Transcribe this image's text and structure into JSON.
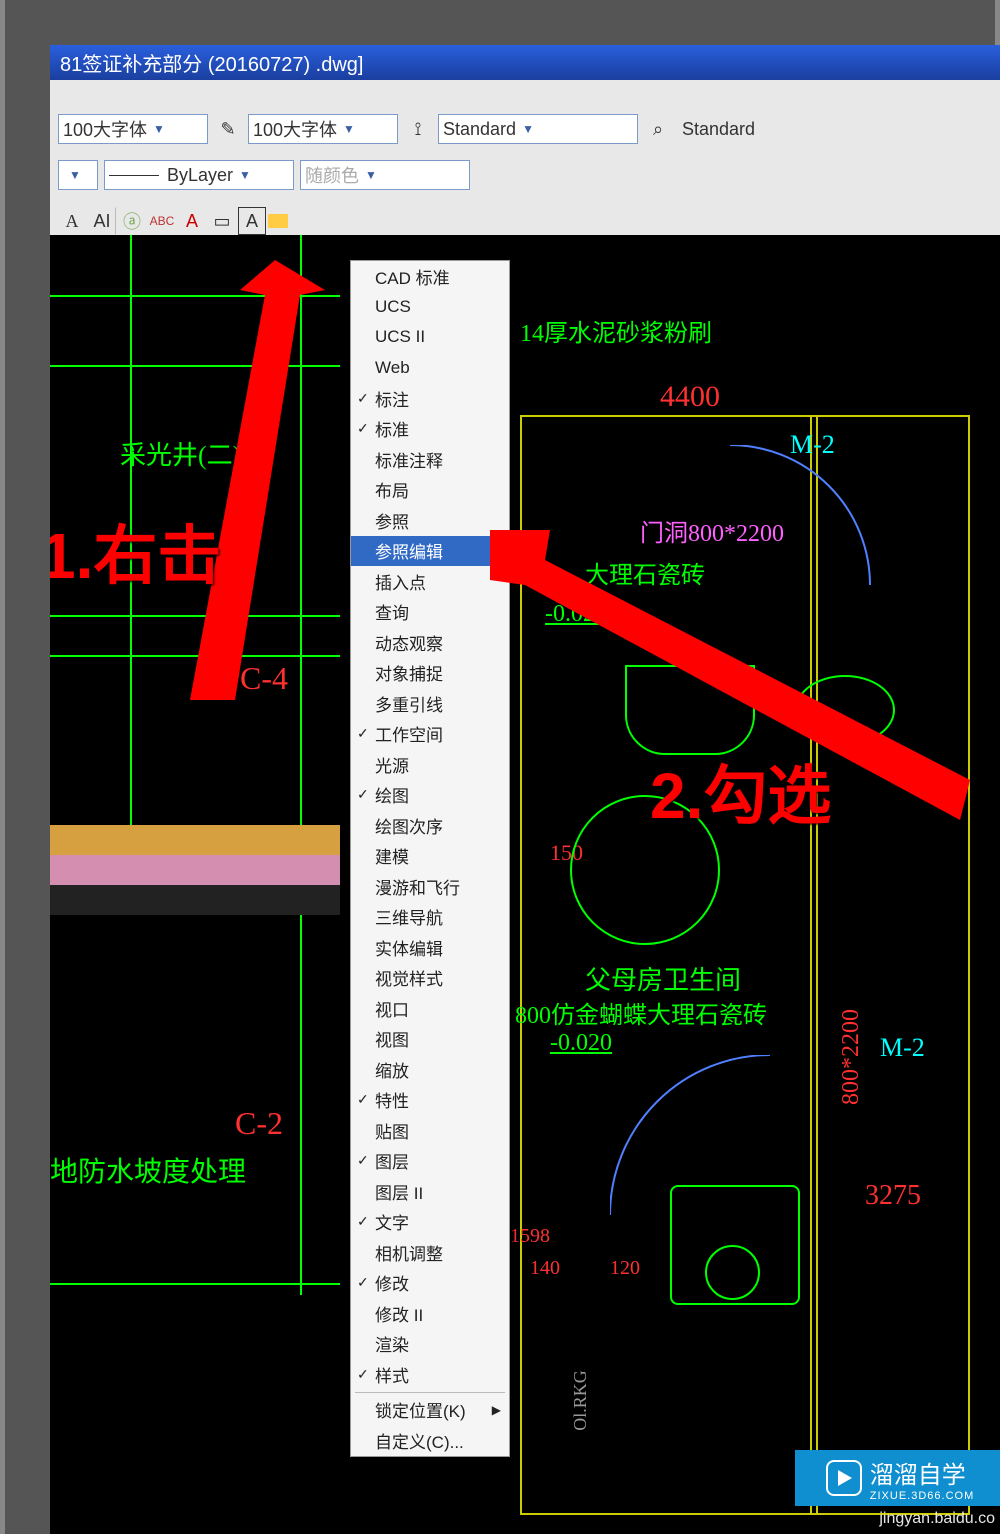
{
  "titlebar": {
    "text": "81签证补充部分 (20160727) .dwg]"
  },
  "toolbar": {
    "font1": "100大字体",
    "font2": "100大字体",
    "style1": "Standard",
    "style2": "Standard",
    "layer_style": "ByLayer",
    "color": "随颜色"
  },
  "context_menu": {
    "items": [
      {
        "label": "CAD 标准",
        "checked": false
      },
      {
        "label": "UCS",
        "checked": false
      },
      {
        "label": "UCS II",
        "checked": false
      },
      {
        "label": "Web",
        "checked": false
      },
      {
        "label": "标注",
        "checked": true
      },
      {
        "label": "标准",
        "checked": true
      },
      {
        "label": "标准注释",
        "checked": false
      },
      {
        "label": "布局",
        "checked": false
      },
      {
        "label": "参照",
        "checked": false
      },
      {
        "label": "参照编辑",
        "checked": false,
        "highlight": true
      },
      {
        "label": "插入点",
        "checked": false
      },
      {
        "label": "查询",
        "checked": false
      },
      {
        "label": "动态观察",
        "checked": false
      },
      {
        "label": "对象捕捉",
        "checked": false
      },
      {
        "label": "多重引线",
        "checked": false
      },
      {
        "label": "工作空间",
        "checked": true
      },
      {
        "label": "光源",
        "checked": false
      },
      {
        "label": "绘图",
        "checked": true
      },
      {
        "label": "绘图次序",
        "checked": false
      },
      {
        "label": "建模",
        "checked": false
      },
      {
        "label": "漫游和飞行",
        "checked": false
      },
      {
        "label": "三维导航",
        "checked": false
      },
      {
        "label": "实体编辑",
        "checked": false
      },
      {
        "label": "视觉样式",
        "checked": false
      },
      {
        "label": "视口",
        "checked": false
      },
      {
        "label": "视图",
        "checked": false
      },
      {
        "label": "缩放",
        "checked": false
      },
      {
        "label": "特性",
        "checked": true
      },
      {
        "label": "贴图",
        "checked": false
      },
      {
        "label": "图层",
        "checked": true
      },
      {
        "label": "图层 II",
        "checked": false
      },
      {
        "label": "文字",
        "checked": true
      },
      {
        "label": "相机调整",
        "checked": false
      },
      {
        "label": "修改",
        "checked": true
      },
      {
        "label": "修改 II",
        "checked": false
      },
      {
        "label": "渲染",
        "checked": false
      },
      {
        "label": "样式",
        "checked": true
      }
    ],
    "footer": [
      {
        "label": "锁定位置(K)",
        "submenu": true
      },
      {
        "label": "自定义(C)..."
      }
    ]
  },
  "drawing": {
    "labels": {
      "caiguangjing": "采光井(二)",
      "c4": "C-4",
      "c2": "C-2",
      "fangshuipo": "地防水坡度处理",
      "houshuini": "14厚水泥砂浆粉刷",
      "dim4400": "4400",
      "m2a": "M-2",
      "m2b": "M-2",
      "mendong": "门洞800*2200",
      "dali1": "大理石瓷砖",
      "neg0020a": "-0.020",
      "fumu": "父母房卫生间",
      "fangjin": "800仿金蝴蝶大理石瓷砖",
      "neg0020b": "-0.020",
      "dim800x2200": "800*2200",
      "dim3275": "3275",
      "dim140": "140",
      "dim120": "120",
      "dim1598": "1598",
      "dim150": "150",
      "olrkg": "Ol.RKG"
    }
  },
  "annotations": {
    "step1": "1.右击",
    "step2": "2.勾选"
  },
  "watermark": {
    "brand": "溜溜自学",
    "sub": "ZIXUE.3D66.COM"
  },
  "credit": "jingyan.baidu.co"
}
